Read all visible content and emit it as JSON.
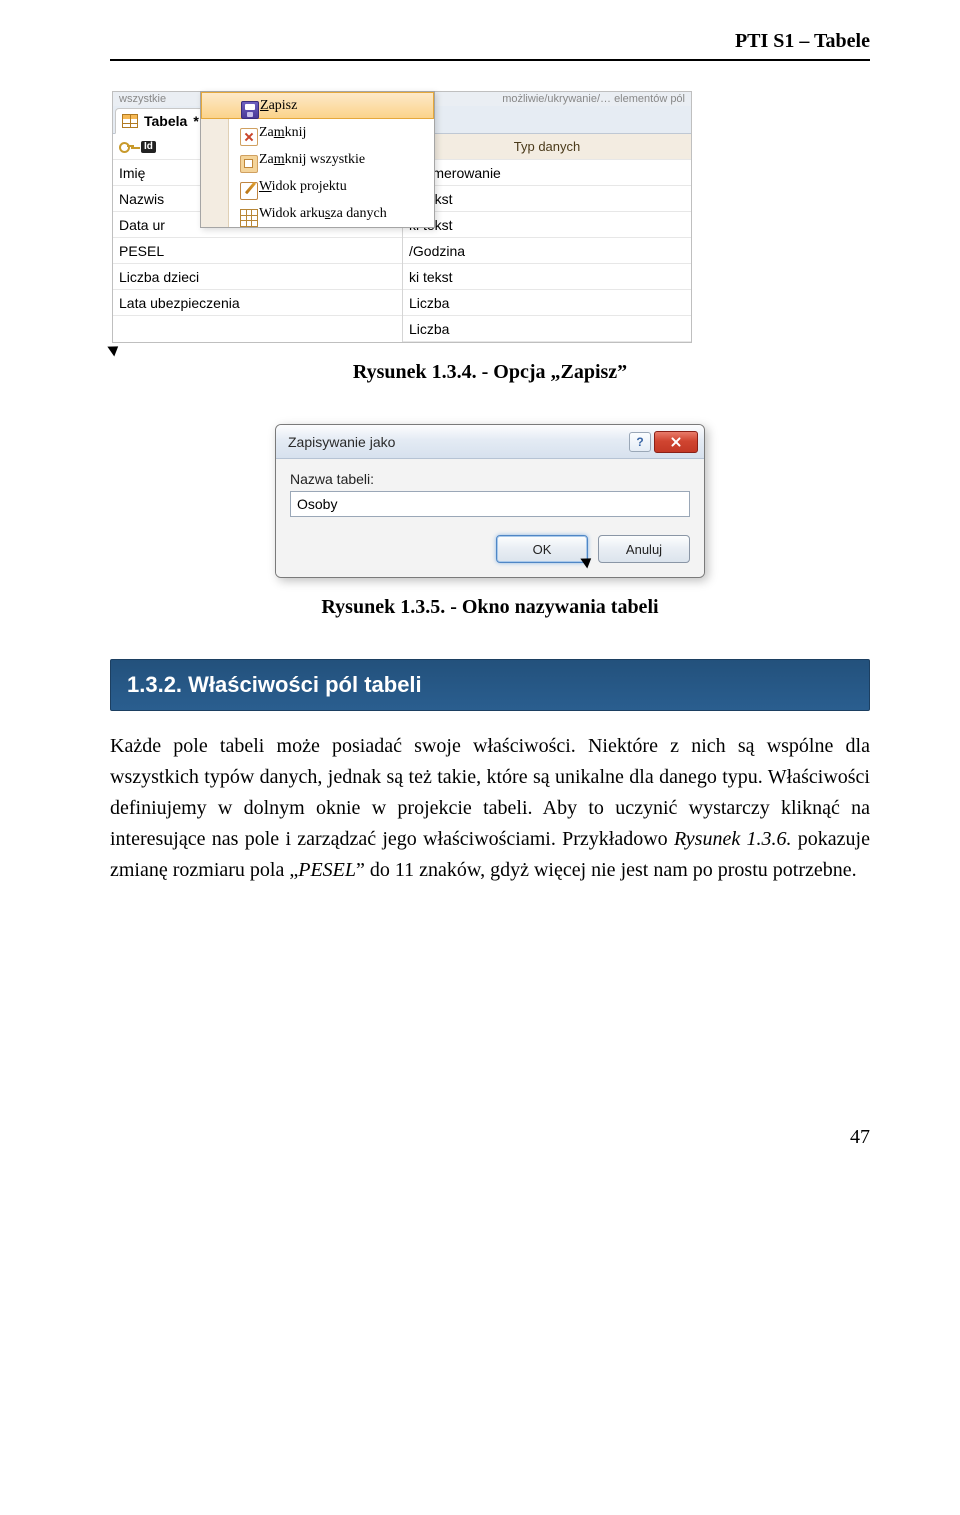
{
  "header": {
    "title": "PTI S1 – Tabele"
  },
  "figure1": {
    "tab_label": "Tabela",
    "top_left_faded": "wszystkie",
    "top_right_faded": "możliwie/ukrywanie/… elementów pól",
    "col_headers": {
      "left_fragment": "",
      "right": "Typ danych"
    },
    "rows_left": [
      "Id",
      "Imię",
      "Nazwis",
      "Data ur",
      "PESEL",
      "Liczba dzieci",
      "Lata ubezpieczenia"
    ],
    "rows_right": [
      "onumerowanie",
      "ki tekst",
      "ki tekst",
      "/Godzina",
      "ki tekst",
      "Liczba",
      "Liczba"
    ],
    "menu_items": [
      {
        "label_pre": "",
        "u": "Z",
        "label_post": "apisz",
        "icon": "save"
      },
      {
        "label_pre": "Za",
        "u": "m",
        "label_post": "knij",
        "icon": "close"
      },
      {
        "label_pre": "Za",
        "u": "m",
        "label_post": "knij wszystkie",
        "icon": "closeall"
      },
      {
        "label_pre": "",
        "u": "W",
        "label_post": "idok projektu",
        "icon": "design"
      },
      {
        "label_pre": "Widok arku",
        "u": "s",
        "label_post": "za danych",
        "icon": "sheet"
      }
    ],
    "caption": "Rysunek 1.3.4. - Opcja „Zapisz”"
  },
  "figure2": {
    "title": "Zapisywanie jako",
    "field_label": "Nazwa tabeli:",
    "field_value": "Osoby",
    "ok": "OK",
    "cancel": "Anuluj",
    "caption": "Rysunek 1.3.5. - Okno nazywania tabeli"
  },
  "section": {
    "heading": "1.3.2. Właściwości pól tabeli"
  },
  "paragraph": {
    "p1": "Każde pole tabeli może posiadać swoje właściwości. Niektóre z nich są wspólne dla wszystkich typów danych, jednak są też takie, które są unikalne dla danego typu. Właściwości definiujemy w dolnym oknie w projekcie tabeli. Aby to uczynić wystarczy kliknąć na interesujące nas pole i zarządzać jego właściwościami. Przykładowo ",
    "cite": "Rysunek 1.3.6.",
    "p2": " pokazuje zmianę rozmiaru pola „",
    "cite2": "PESEL",
    "p3": "” do 11 znaków, gdyż więcej nie jest nam po prostu potrzebne."
  },
  "page_number": "47"
}
